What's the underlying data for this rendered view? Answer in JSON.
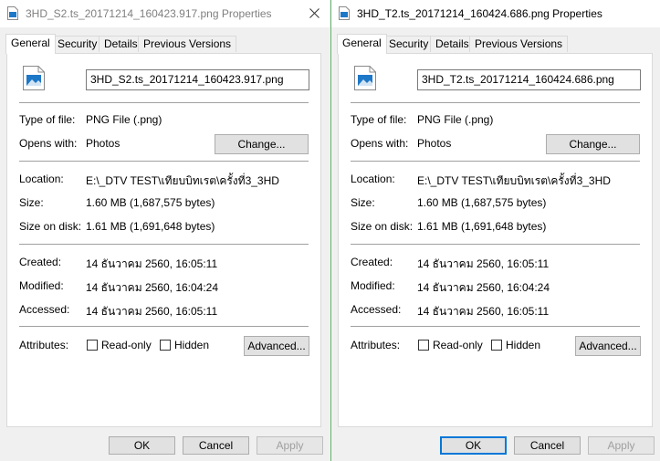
{
  "windows": [
    {
      "title": "3HD_S2.ts_20171214_160423.917.png Properties",
      "tabs": [
        "General",
        "Security",
        "Details",
        "Previous Versions"
      ],
      "filename": "3HD_S2.ts_20171214_160423.917.png",
      "type_label": "Type of file:",
      "type_value": "PNG File (.png)",
      "opens_label": "Opens with:",
      "opens_value": "Photos",
      "change_label": "Change...",
      "location_label": "Location:",
      "location_value": "E:\\_DTV TEST\\เทียบบิทเรต\\ครั้งที่3_3HD",
      "size_label": "Size:",
      "size_value": "1.60 MB (1,687,575 bytes)",
      "disk_label": "Size on disk:",
      "disk_value": "1.61 MB (1,691,648 bytes)",
      "created_label": "Created:",
      "created_value": "14 ธันวาคม 2560, 16:05:11",
      "modified_label": "Modified:",
      "modified_value": "14 ธันวาคม 2560, 16:04:24",
      "accessed_label": "Accessed:",
      "accessed_value": "14 ธันวาคม 2560, 16:05:11",
      "attributes_label": "Attributes:",
      "readonly_label": "Read-only",
      "hidden_label": "Hidden",
      "advanced_label": "Advanced...",
      "ok_label": "OK",
      "cancel_label": "Cancel",
      "apply_label": "Apply"
    },
    {
      "title": "3HD_T2.ts_20171214_160424.686.png Properties",
      "tabs": [
        "General",
        "Security",
        "Details",
        "Previous Versions"
      ],
      "filename": "3HD_T2.ts_20171214_160424.686.png",
      "type_label": "Type of file:",
      "type_value": "PNG File (.png)",
      "opens_label": "Opens with:",
      "opens_value": "Photos",
      "change_label": "Change...",
      "location_label": "Location:",
      "location_value": "E:\\_DTV TEST\\เทียบบิทเรต\\ครั้งที่3_3HD",
      "size_label": "Size:",
      "size_value": "1.60 MB (1,687,575 bytes)",
      "disk_label": "Size on disk:",
      "disk_value": "1.61 MB (1,691,648 bytes)",
      "created_label": "Created:",
      "created_value": "14 ธันวาคม 2560, 16:05:11",
      "modified_label": "Modified:",
      "modified_value": "14 ธันวาคม 2560, 16:04:24",
      "accessed_label": "Accessed:",
      "accessed_value": "14 ธันวาคม 2560, 16:05:11",
      "attributes_label": "Attributes:",
      "readonly_label": "Read-only",
      "hidden_label": "Hidden",
      "advanced_label": "Advanced...",
      "ok_label": "OK",
      "cancel_label": "Cancel",
      "apply_label": "Apply"
    }
  ],
  "icons": {
    "file": "image-file-icon",
    "close": "close-icon"
  },
  "colors": {
    "active_border": "#63b26a",
    "default_button": "#0078d7",
    "icon_blue": "#1e78c8"
  }
}
